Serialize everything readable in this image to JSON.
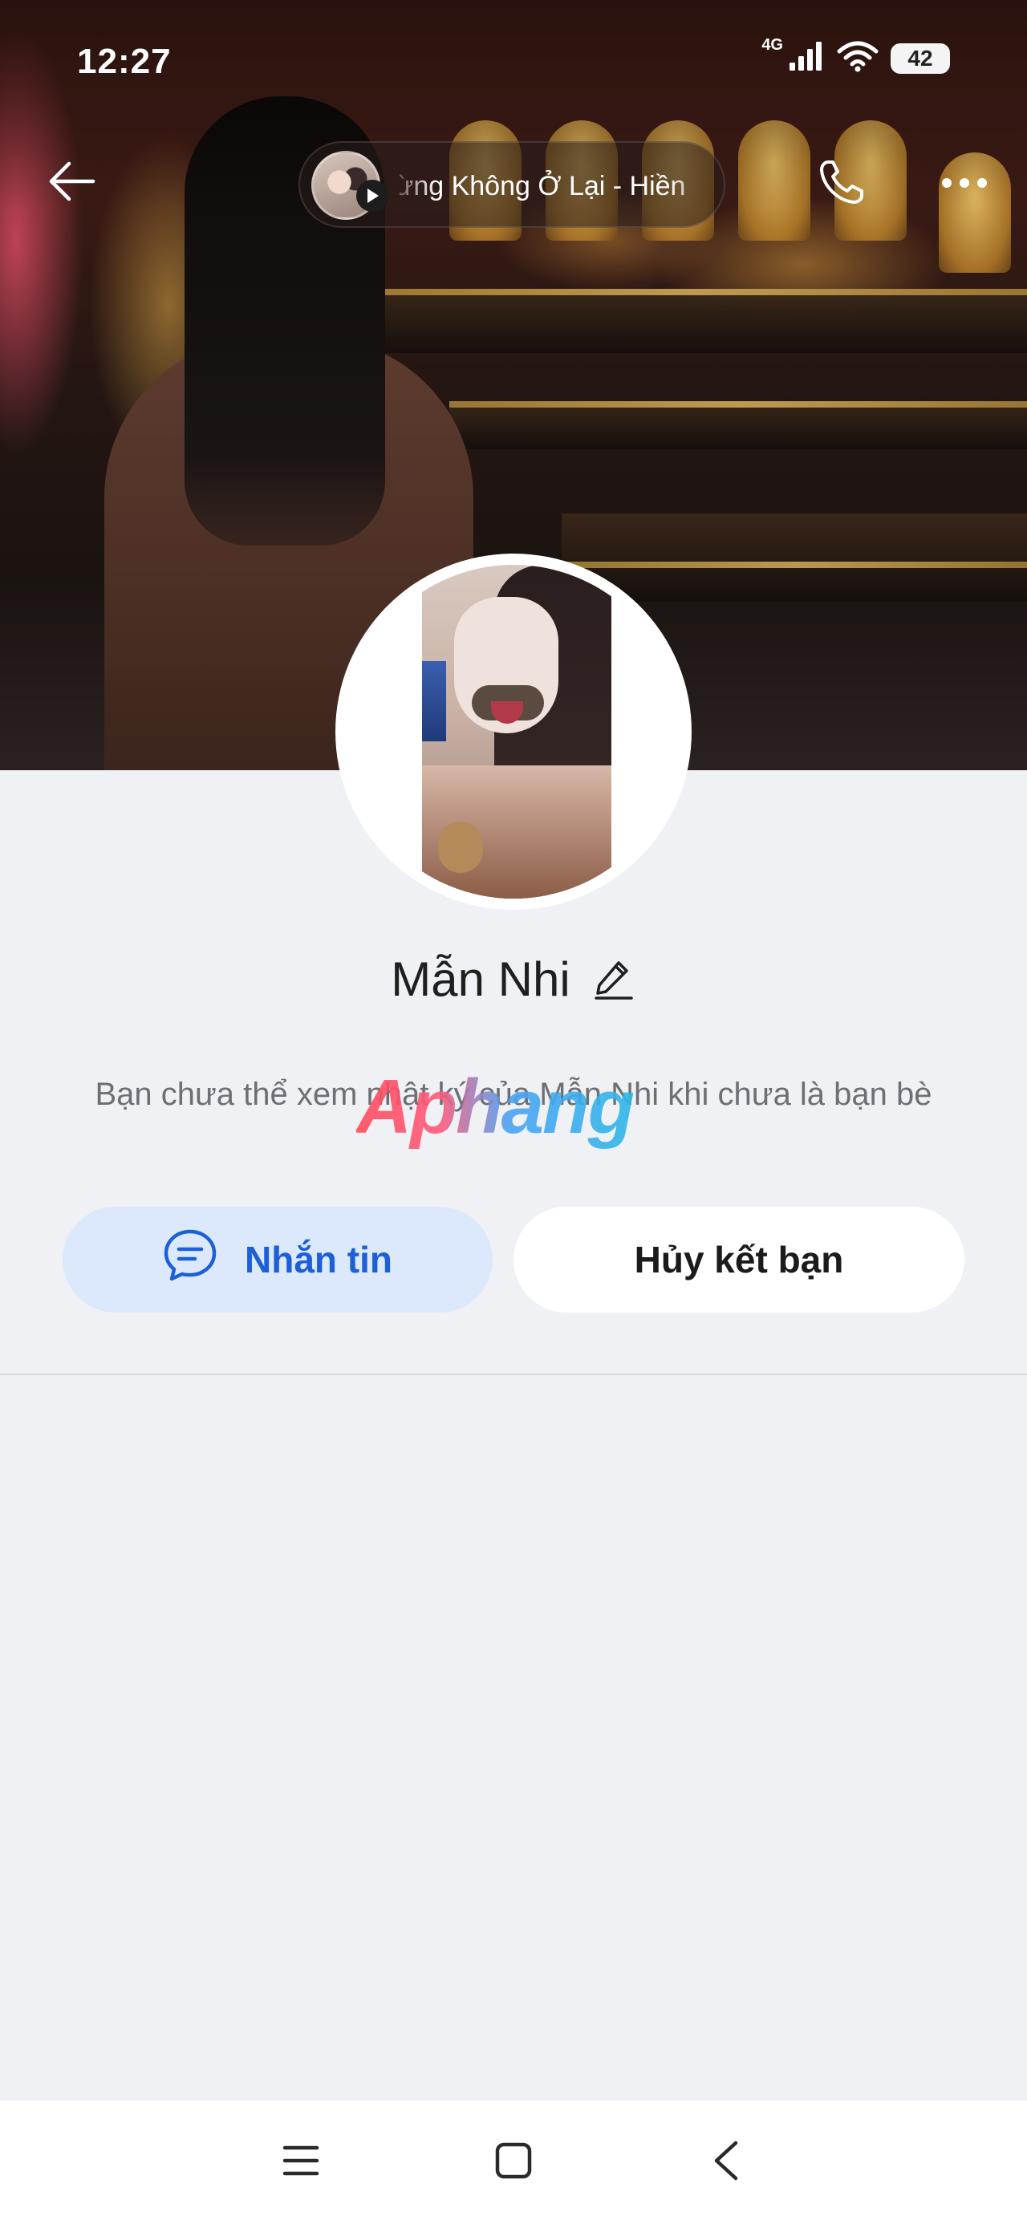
{
  "status_bar": {
    "time": "12:27",
    "network": "4G",
    "battery": "42"
  },
  "top_nav": {
    "music_title": "Dừng Không Ở Lại - Hiền"
  },
  "profile": {
    "name": "Mẫn Nhi",
    "notice": "Bạn chưa thể xem nhật ký của Mẫn Nhi khi chưa là bạn bè",
    "watermark": "Aphang"
  },
  "actions": {
    "message_label": "Nhắn tin",
    "unfriend_label": "Hủy kết bạn"
  },
  "colors": {
    "accent": "#1d5fd6",
    "message_bg": "#dce9fd",
    "page_bg": "#f0f1f4"
  },
  "icons": {
    "back": "arrow-left-icon",
    "play": "play-icon",
    "call": "phone-icon",
    "more": "more-horizontal-icon",
    "edit": "pencil-icon",
    "message": "chat-bubble-icon",
    "sys_menu": "menu-icon",
    "sys_home": "square-home-icon",
    "sys_back": "chevron-left-icon"
  }
}
